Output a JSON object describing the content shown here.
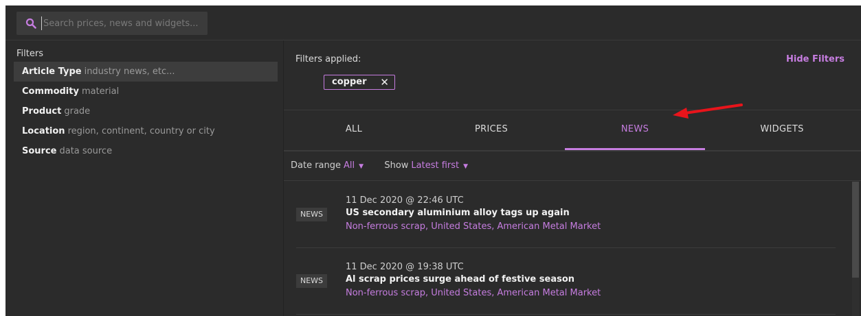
{
  "search": {
    "placeholder": "Search prices, news and widgets..."
  },
  "filters": {
    "title": "Filters",
    "items": [
      {
        "name": "Article Type",
        "hint": "industry news, etc..."
      },
      {
        "name": "Commodity",
        "hint": "material"
      },
      {
        "name": "Product",
        "hint": "grade"
      },
      {
        "name": "Location",
        "hint": "region, continent, country or city"
      },
      {
        "name": "Source",
        "hint": "data source"
      }
    ]
  },
  "applied": {
    "title": "Filters applied:",
    "hide_label": "Hide Filters",
    "chips": [
      {
        "label": "copper",
        "close": "✕"
      }
    ]
  },
  "tabs": [
    "ALL",
    "PRICES",
    "NEWS",
    "WIDGETS"
  ],
  "active_tab": "NEWS",
  "options": {
    "date_label": "Date range",
    "date_value": "All",
    "show_label": "Show",
    "show_value": "Latest first"
  },
  "news": [
    {
      "badge": "NEWS",
      "time": "11 Dec 2020 @ 22:46 UTC",
      "title": "US secondary aluminium alloy tags up again",
      "tags": "Non-ferrous scrap, United States, American Metal Market"
    },
    {
      "badge": "NEWS",
      "time": "11 Dec 2020 @ 19:38 UTC",
      "title": "Al scrap prices surge ahead of festive season",
      "tags": "Non-ferrous scrap, United States, American Metal Market"
    }
  ],
  "colors": {
    "accent": "#c67de0",
    "background": "#2b2b2b",
    "annotation_arrow": "#e8141b"
  },
  "icons": {
    "search": "search-icon",
    "close": "close-icon",
    "caret": "caret-down-icon",
    "arrow": "red-arrow-annotation"
  }
}
